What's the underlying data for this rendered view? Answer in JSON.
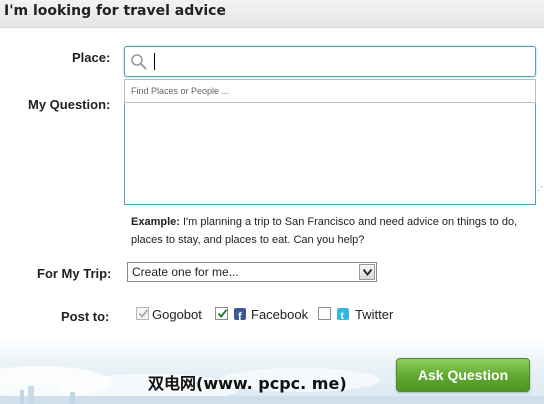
{
  "header": {
    "title": "I'm looking for travel advice"
  },
  "form": {
    "place_label": "Place:",
    "place_value": "",
    "place_suggest": "Find Places or People ...",
    "question_label": "My Question:",
    "question_value": "",
    "example_label": "Example:",
    "example_text": " I'm planning a trip to San Francisco and need advice on things to do, places to stay, and places to eat. Can you help?",
    "trip_label": "For My Trip:",
    "trip_selected": "Create one for me...",
    "post_label": "Post to:",
    "post_options": [
      {
        "label": "Gogobot",
        "checked": true,
        "disabled": true
      },
      {
        "label": "Facebook",
        "checked": true,
        "disabled": false
      },
      {
        "label": "Twitter",
        "checked": false,
        "disabled": false
      }
    ],
    "submit_label": "Ask Question"
  },
  "watermark": "双电网(www. pcpc. me)",
  "colors": {
    "accent_teal": "#4aa7b8",
    "button_green": "#5fa831",
    "facebook_blue": "#3b5998",
    "twitter_blue": "#33b5e5"
  }
}
